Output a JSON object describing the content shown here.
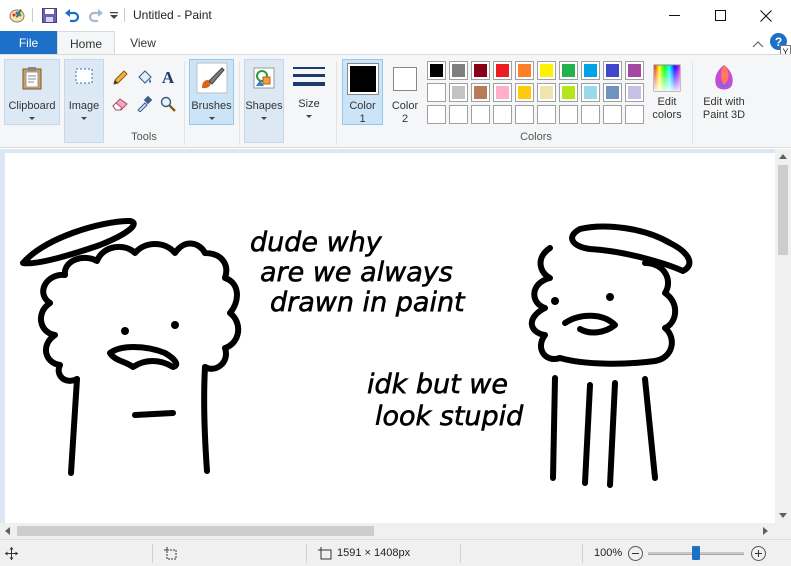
{
  "window": {
    "title": "Untitled - Paint"
  },
  "tabs": {
    "file": "File",
    "home": "Home",
    "view": "View"
  },
  "ribbon": {
    "clipboard": "Clipboard",
    "image": "Image",
    "tools_group": "Tools",
    "brushes": "Brushes",
    "shapes": "Shapes",
    "size": "Size",
    "color1_line1": "Color",
    "color1_line2": "1",
    "color2_line1": "Color",
    "color2_line2": "2",
    "colors_group": "Colors",
    "edit_colors_line1": "Edit",
    "edit_colors_line2": "colors",
    "paint3d_line1": "Edit with",
    "paint3d_line2": "Paint 3D"
  },
  "palette": {
    "row1": [
      "#000000",
      "#7f7f7f",
      "#880015",
      "#ed1c24",
      "#ff7f27",
      "#fff200",
      "#22b14c",
      "#00a2e8",
      "#3f48cc",
      "#a349a4"
    ],
    "row2": [
      "#ffffff",
      "#c3c3c3",
      "#b97a57",
      "#ffaec9",
      "#ffc90e",
      "#efe4b0",
      "#b5e61d",
      "#99d9ea",
      "#7092be",
      "#c8bfe7"
    ],
    "row3": [
      "#ffffff",
      "#ffffff",
      "#ffffff",
      "#ffffff",
      "#ffffff",
      "#ffffff",
      "#ffffff",
      "#ffffff",
      "#ffffff",
      "#ffffff"
    ],
    "color1": "#000000",
    "color2": "#ffffff"
  },
  "canvas": {
    "speech1_line1": "dude why",
    "speech1_line2": "are we always",
    "speech1_line3": "drawn in paint",
    "speech2_line1": "idk but we",
    "speech2_line2": "look stupid"
  },
  "status": {
    "dimensions": "1591 × 1408px",
    "zoom": "100%",
    "zoom_level": 0.5
  },
  "help_hint": "Y"
}
